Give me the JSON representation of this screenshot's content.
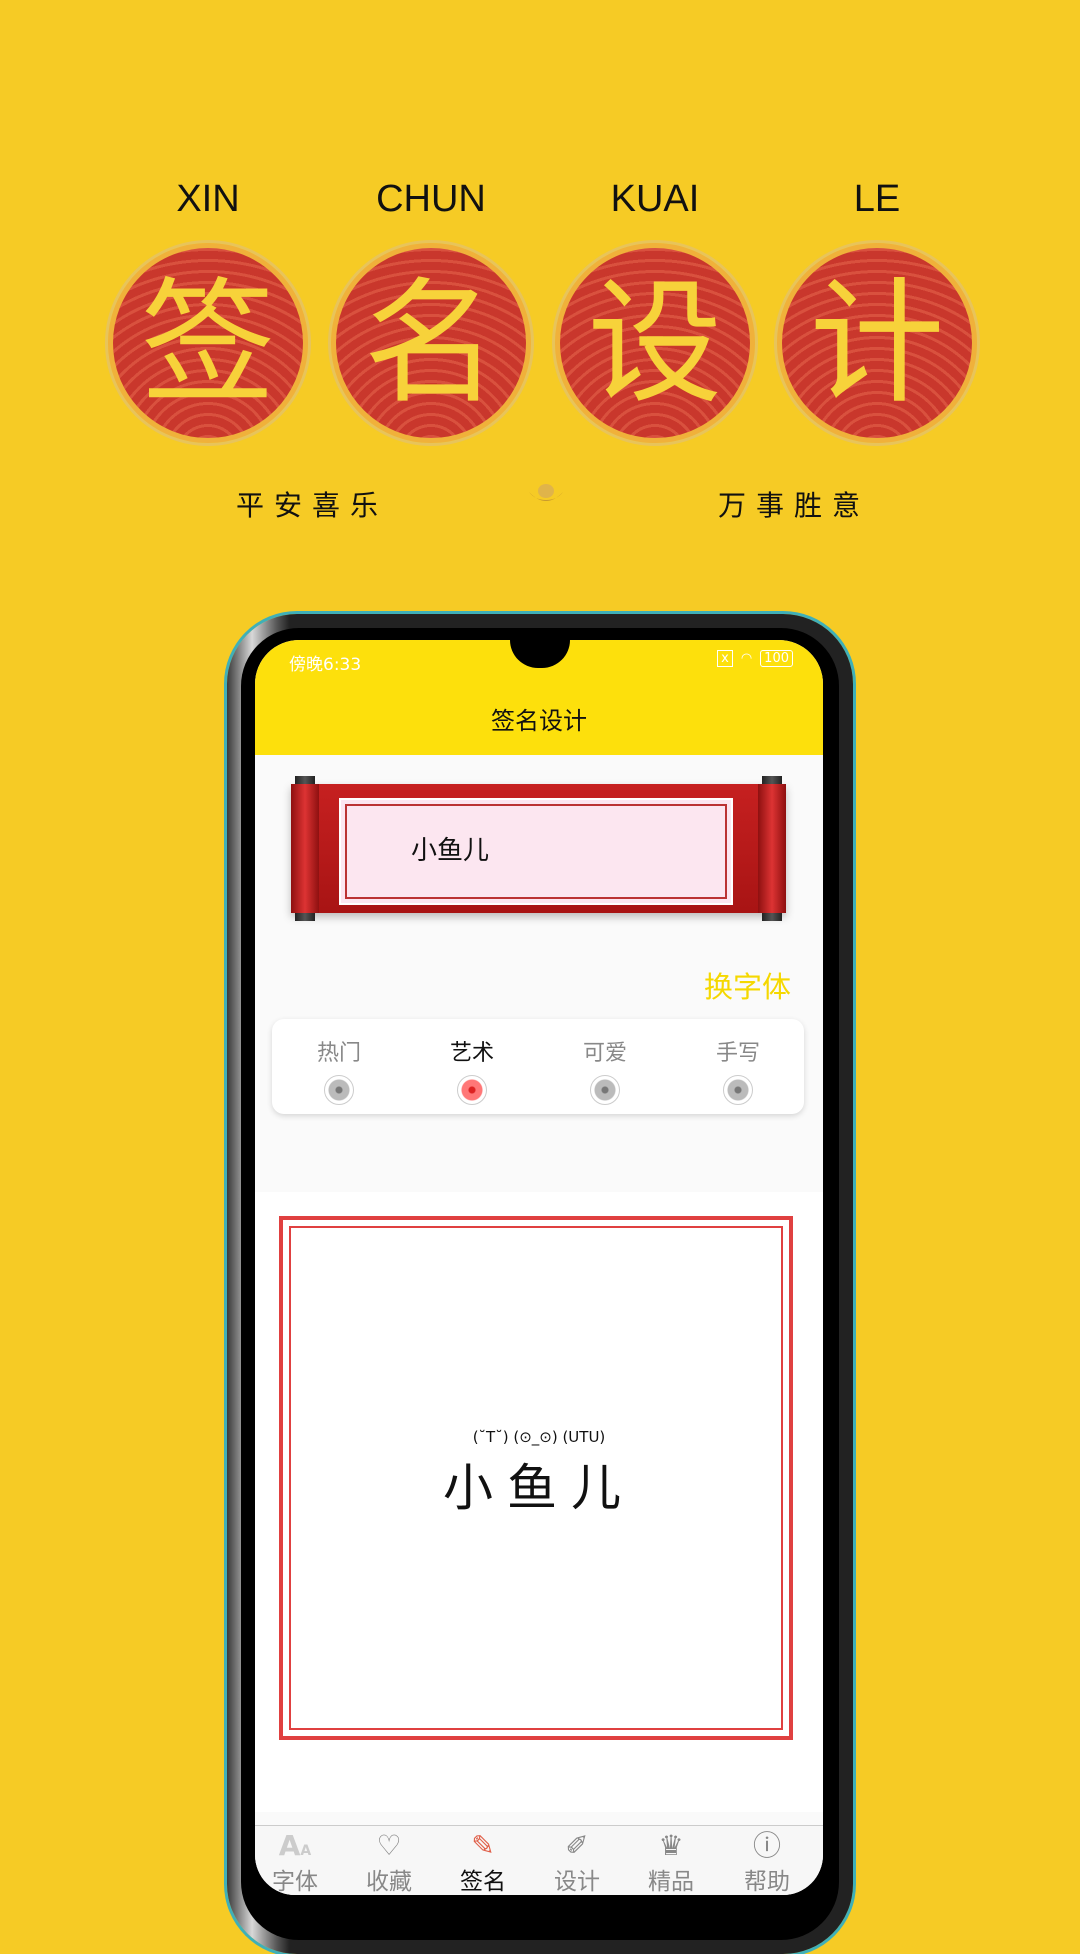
{
  "banner": {
    "pinyin": [
      "XIN",
      "CHUN",
      "KUAI",
      "LE"
    ],
    "characters": [
      "签",
      "名",
      "设",
      "计"
    ],
    "left_phrase": "平安喜乐",
    "right_phrase": "万事胜意",
    "ingot_icon": "gold-ingot-icon"
  },
  "status_bar": {
    "time": "傍晚6:33",
    "battery": "100"
  },
  "header": {
    "title": "签名设计"
  },
  "preview": {
    "name": "小鱼儿"
  },
  "change_font_label": "换字体",
  "font_tabs": [
    {
      "label": "热门",
      "active": false
    },
    {
      "label": "艺术",
      "active": true
    },
    {
      "label": "可爱",
      "active": false
    },
    {
      "label": "手写",
      "active": false
    }
  ],
  "signature": {
    "emoticons": "(˘T˘) (⊙_⊙) (UTU)",
    "name": "小鱼儿"
  },
  "bottom_nav": [
    {
      "label": "字体",
      "icon": "font-icon"
    },
    {
      "label": "收藏",
      "icon": "heart-icon"
    },
    {
      "label": "签名",
      "icon": "edit-icon",
      "active": true
    },
    {
      "label": "设计",
      "icon": "design-tools-icon"
    },
    {
      "label": "精品",
      "icon": "crown-icon"
    },
    {
      "label": "帮助",
      "icon": "help-icon"
    }
  ],
  "colors": {
    "background": "#f6cb25",
    "header": "#fde00c",
    "accent": "#f5d800",
    "scroll_red": "#b81c1c",
    "frame_red": "#e04040"
  }
}
